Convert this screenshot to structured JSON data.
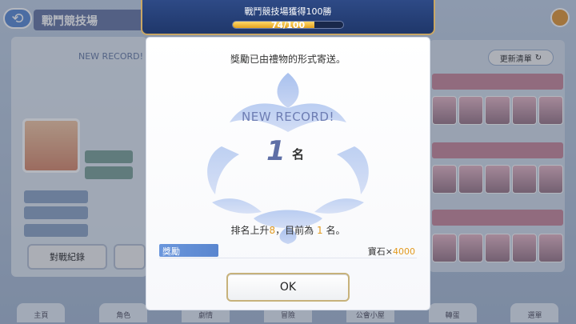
{
  "background": {
    "page_title": "戰鬥競技場",
    "left_record_text": "NEW RECORD!",
    "left_buttons": [
      "對戰紀錄",
      ""
    ],
    "refresh_label": "更新清單",
    "nav_labels": [
      "主頁",
      "角色",
      "劇情",
      "冒險",
      "公會小屋",
      "轉蛋",
      "選單"
    ]
  },
  "banner": {
    "title": "戰鬥競技場獲得100勝",
    "progress_text": "74/100",
    "progress_fraction": 0.74
  },
  "modal": {
    "message": "獎勵已由禮物的形式寄送。",
    "new_record": "NEW RECORD!",
    "rank_number": "1",
    "rank_suffix": "名",
    "rank_line_prefix": "排名上升",
    "rank_up": "8",
    "rank_line_middle": "，目前為",
    "current_rank": "1",
    "rank_line_suffix": "名。",
    "reward_label": "獎勵",
    "reward_item": "寶石×",
    "reward_qty": "4000",
    "ok_label": "OK"
  },
  "colors": {
    "accent_blue": "#5a86cf",
    "highlight_orange": "#e39a1e",
    "banner_bg": "#1f376a",
    "progress_fill": "#e3a21d"
  }
}
